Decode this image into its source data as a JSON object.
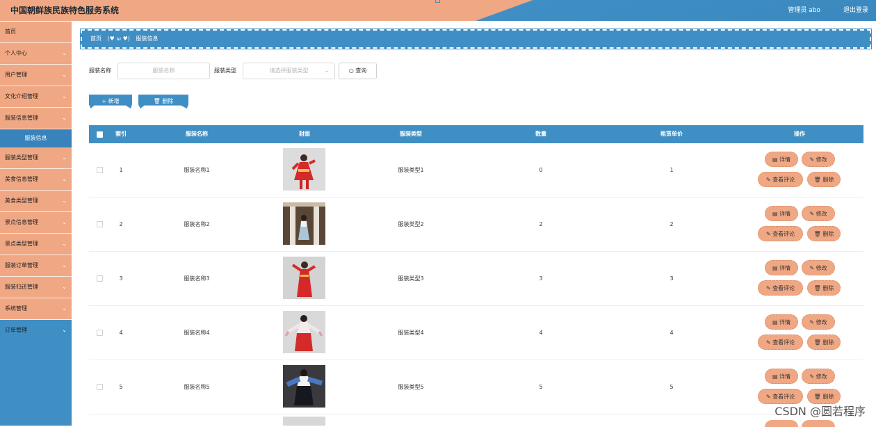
{
  "app": {
    "title": "中国朝鲜族民族特色服务系统",
    "user_label": "管理员 abo",
    "logout_label": "退出登录"
  },
  "sidebar": {
    "items": [
      {
        "label": "首页",
        "has_arrow": false
      },
      {
        "label": "个人中心",
        "has_arrow": true
      },
      {
        "label": "用户管理",
        "has_arrow": true
      },
      {
        "label": "文化介绍管理",
        "has_arrow": true
      },
      {
        "label": "服装信息管理",
        "has_arrow": true,
        "expanded": true,
        "sub": "服装信息"
      },
      {
        "label": "服装类型管理",
        "has_arrow": true
      },
      {
        "label": "美食信息管理",
        "has_arrow": true
      },
      {
        "label": "美食类型管理",
        "has_arrow": true
      },
      {
        "label": "景点信息管理",
        "has_arrow": true
      },
      {
        "label": "景点类型管理",
        "has_arrow": true
      },
      {
        "label": "服装订单管理",
        "has_arrow": true
      },
      {
        "label": "服装归还管理",
        "has_arrow": true
      },
      {
        "label": "系统管理",
        "has_arrow": true
      },
      {
        "label": "订单管理",
        "has_arrow": true
      }
    ]
  },
  "breadcrumb": {
    "home": "首页",
    "separator": "(♥ ω ♥)",
    "current": "服装信息"
  },
  "search": {
    "name_label": "服装名称",
    "name_placeholder": "服装名称",
    "type_label": "服装类型",
    "type_placeholder": "请选择服装类型",
    "query_label": "查询"
  },
  "actions": {
    "add_label": "+ 新增",
    "delete_label": "删除"
  },
  "table": {
    "headers": {
      "index": "索引",
      "name": "服装名称",
      "cover": "封面",
      "type": "服装类型",
      "quantity": "数量",
      "price": "租赁单价",
      "ops": "操作"
    },
    "rows": [
      {
        "index": "1",
        "name": "服装名称1",
        "type": "服装类型1",
        "quantity": "0",
        "price": "1"
      },
      {
        "index": "2",
        "name": "服装名称2",
        "type": "服装类型2",
        "quantity": "2",
        "price": "2"
      },
      {
        "index": "3",
        "name": "服装名称3",
        "type": "服装类型3",
        "quantity": "3",
        "price": "3"
      },
      {
        "index": "4",
        "name": "服装名称4",
        "type": "服装类型4",
        "quantity": "4",
        "price": "4"
      },
      {
        "index": "5",
        "name": "服装名称5",
        "type": "服装类型5",
        "quantity": "5",
        "price": "5"
      }
    ],
    "row_buttons": {
      "detail": "详情",
      "edit": "修改",
      "comments": "查看评论",
      "delete": "删除"
    }
  },
  "watermark": "CSDN @圆若程序",
  "colors": {
    "peach": "#f0a884",
    "blue": "#3f8fc4"
  }
}
